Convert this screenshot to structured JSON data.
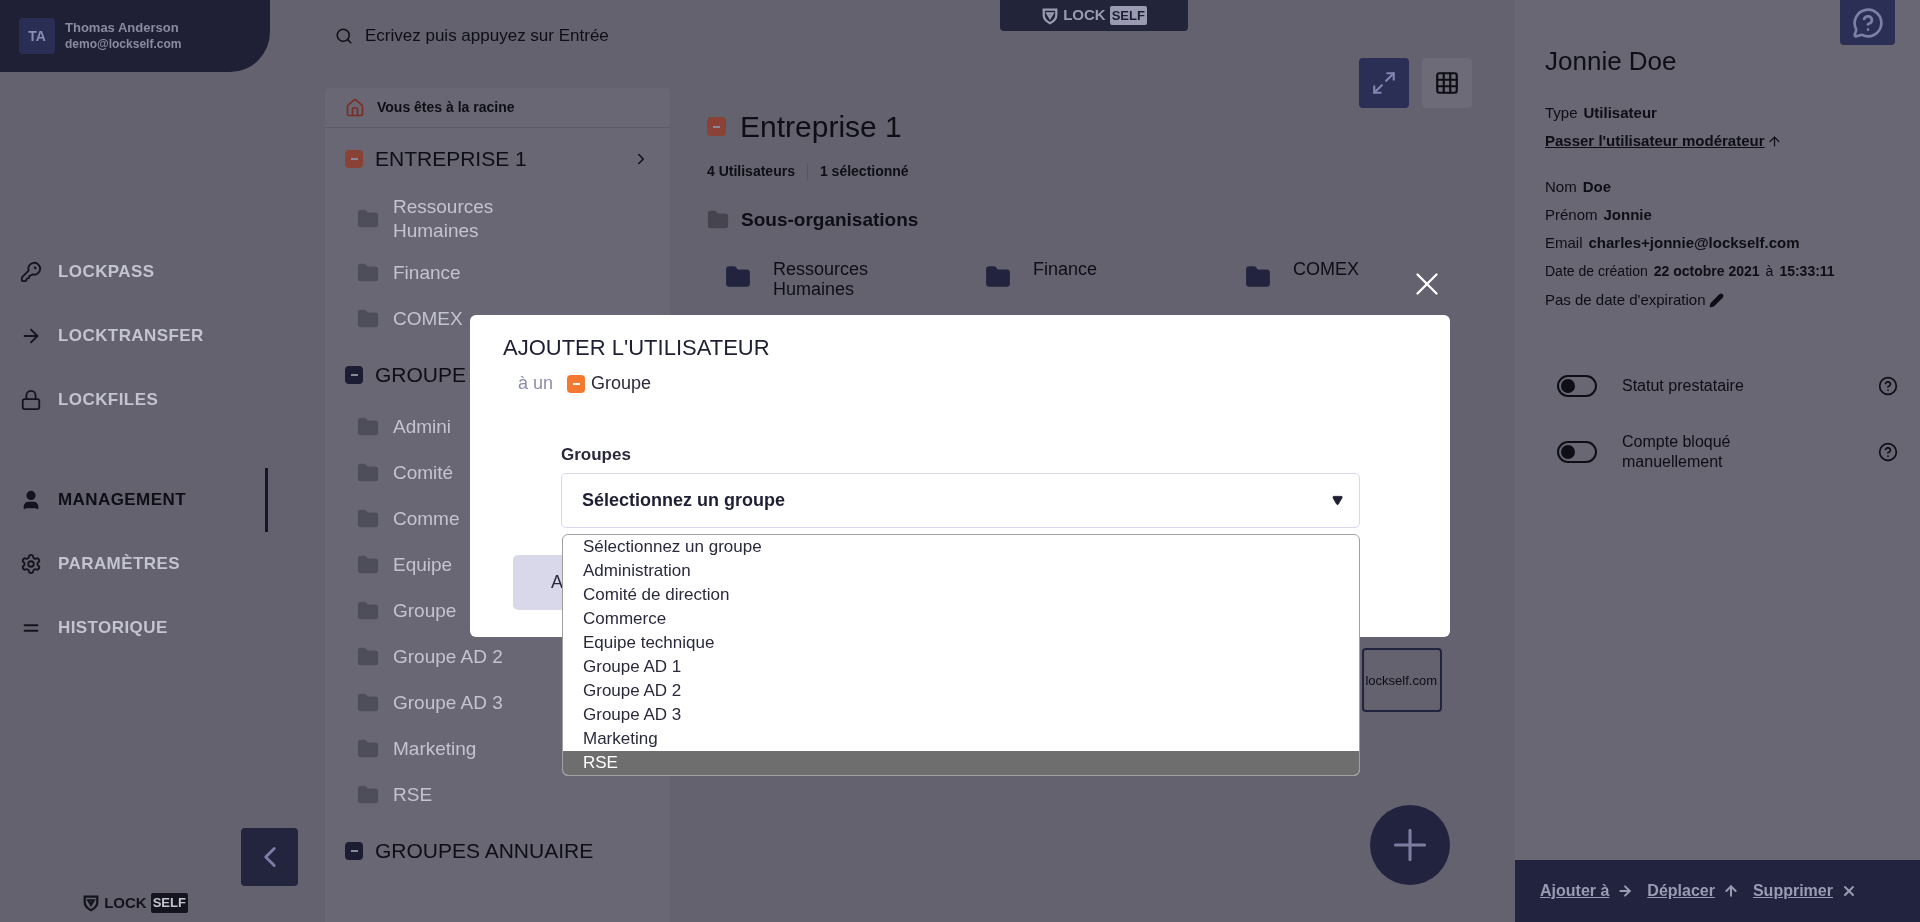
{
  "user": {
    "initials": "TA",
    "name": "Thomas Anderson",
    "email": "demo@lockself.com"
  },
  "nav": [
    {
      "label": "LOCKPASS",
      "selected": false
    },
    {
      "label": "LOCKTRANSFER",
      "selected": false
    },
    {
      "label": "LOCKFILES",
      "selected": false
    },
    {
      "label": "MANAGEMENT",
      "selected": true
    },
    {
      "label": "PARAMÈTRES",
      "selected": false
    },
    {
      "label": "HISTORIQUE",
      "selected": false
    }
  ],
  "logo": [
    {
      "lock": "LOCK",
      "self": "SELF"
    },
    {
      "lock": "LOCK",
      "self": "SELF"
    }
  ],
  "search": {
    "placeholder": "Ecrivez puis appuyez sur Entrée"
  },
  "tree": {
    "breadcrumb": "Vous êtes à la racine",
    "items": [
      {
        "label": "ENTREPRISE 1",
        "color": "#8a4236",
        "chevron": true,
        "children": [
          {
            "label": "Ressources Humaines"
          },
          {
            "label": "Finance"
          },
          {
            "label": "COMEX"
          }
        ]
      },
      {
        "label": "GROUPE",
        "color": "#1c1d33",
        "children": [
          {
            "label": "Admini"
          },
          {
            "label": "Comité"
          },
          {
            "label": "Comme"
          },
          {
            "label": "Equipe"
          },
          {
            "label": "Groupe"
          },
          {
            "label": "Groupe AD 2"
          },
          {
            "label": "Groupe AD 3"
          },
          {
            "label": "Marketing"
          },
          {
            "label": "RSE"
          }
        ]
      },
      {
        "label": "GROUPES ANNUAIRE",
        "color": "#1c1d33"
      }
    ]
  },
  "main": {
    "title": "Entreprise 1",
    "users": "4 Utilisateurs",
    "selected_count": "1 sélectionné",
    "section": "Sous-organisations",
    "cards": [
      "Ressources Humaines",
      "Finance",
      "COMEX"
    ],
    "member_email": "lockself.com"
  },
  "user_panel": {
    "name": "Jonnie Doe",
    "type_label": "Type",
    "type_value": "Utilisateur",
    "promote_link": "Passer l'utilisateur modérateur",
    "fields": [
      {
        "label": "Nom",
        "value": "Doe"
      },
      {
        "label": "Prénom",
        "value": "Jonnie"
      },
      {
        "label": "Email",
        "value": "charles+jonnie@lockself.com"
      }
    ],
    "created_label": "Date de création",
    "created_date": "22 octobre 2021",
    "created_sep": "à",
    "created_time": "15:33:11",
    "expiration": "Pas de date d'expiration",
    "toggles": [
      {
        "label": "Statut prestataire",
        "on": false
      },
      {
        "label": "Compte bloqué manuellement",
        "on": false
      }
    ]
  },
  "actions": [
    "Ajouter à",
    "Déplacer",
    "Supprimer"
  ],
  "modal": {
    "title": "AJOUTER L'UTILISATEUR",
    "prefix": "à un",
    "target": "Groupe",
    "field_label": "Groupes",
    "value": "Sélectionnez un groupe",
    "button": "A",
    "options": [
      {
        "label": "Sélectionnez un groupe",
        "highlighted": false
      },
      {
        "label": "Administration",
        "highlighted": false
      },
      {
        "label": "Comité de direction",
        "highlighted": false
      },
      {
        "label": "Commerce",
        "highlighted": false
      },
      {
        "label": "Equipe technique",
        "highlighted": false
      },
      {
        "label": "Groupe AD 1",
        "highlighted": false
      },
      {
        "label": "Groupe AD 2",
        "highlighted": false
      },
      {
        "label": "Groupe AD 3",
        "highlighted": false
      },
      {
        "label": "Marketing",
        "highlighted": false
      },
      {
        "label": "RSE",
        "highlighted": true
      }
    ]
  }
}
